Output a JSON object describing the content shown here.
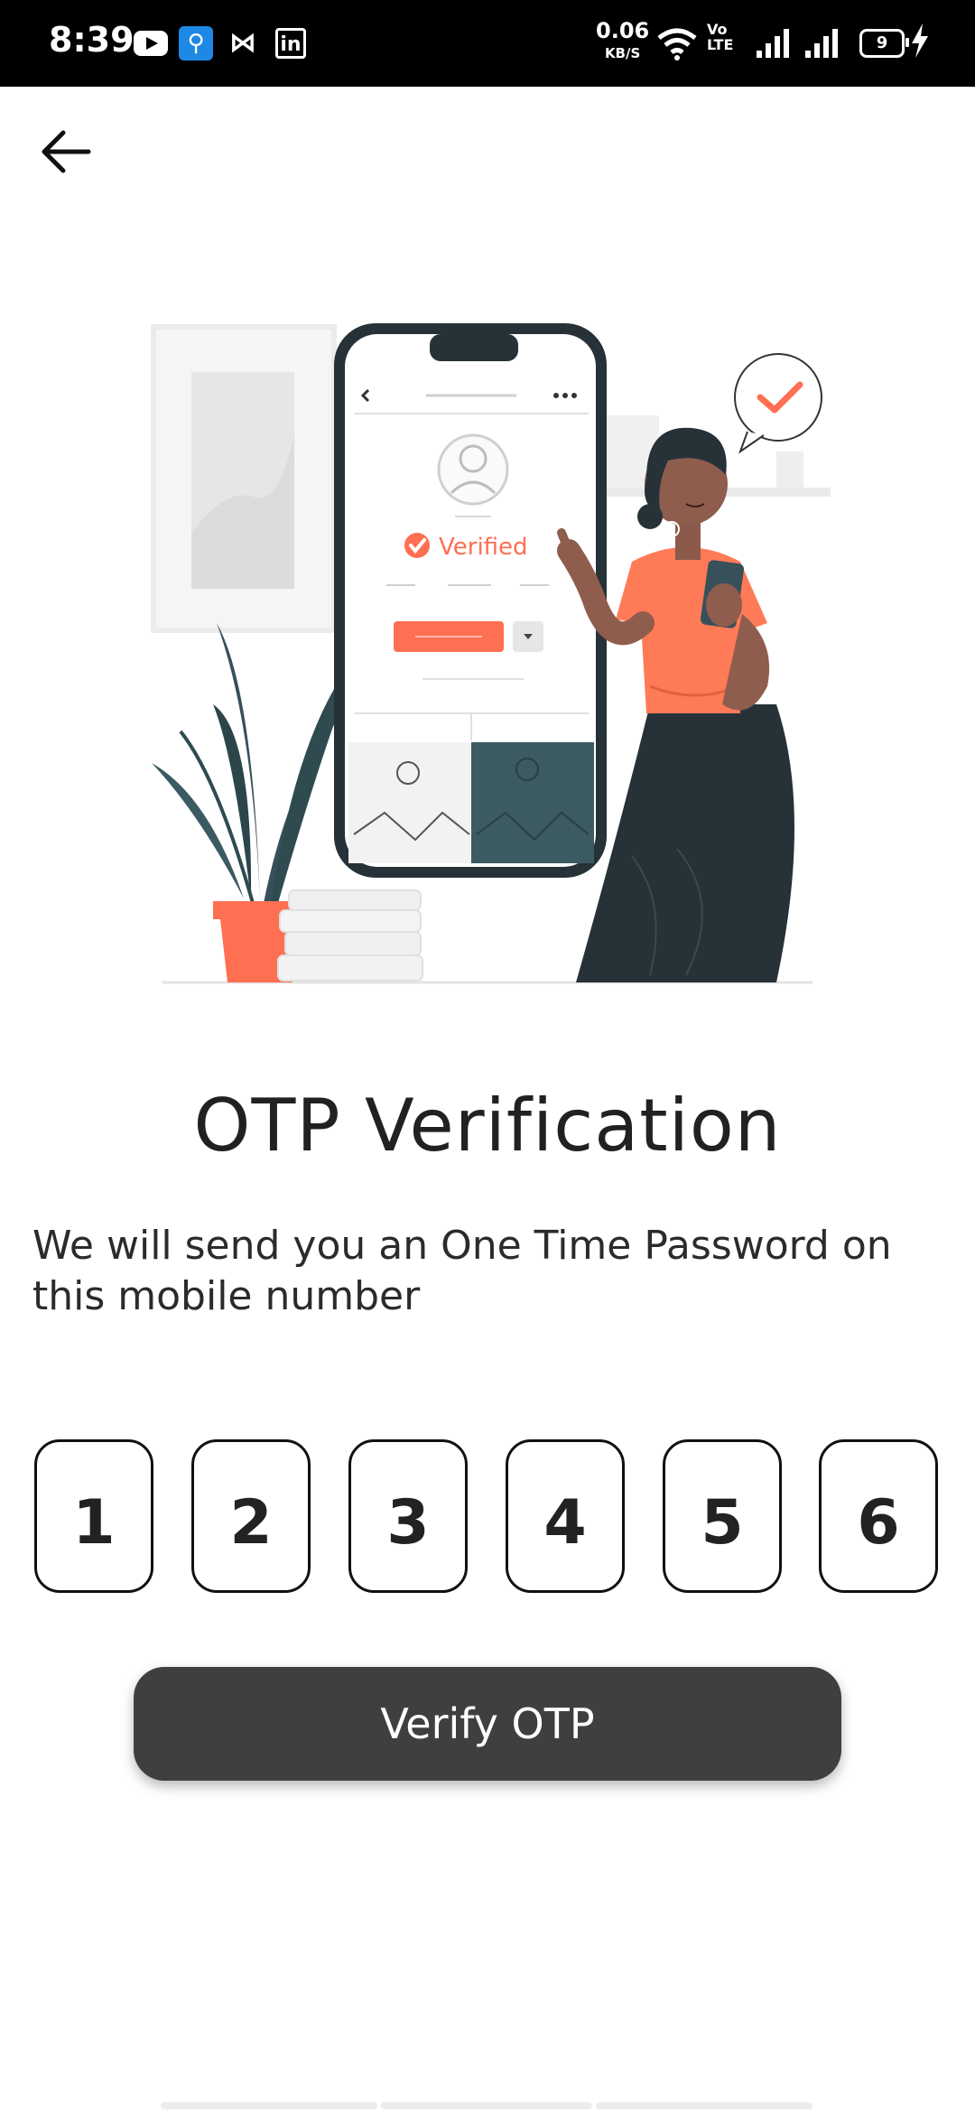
{
  "status_bar": {
    "time": "8:39",
    "net_speed_value": "0.06",
    "net_speed_unit": "KB/S",
    "volte_top": "Vo",
    "volte_bottom": "LTE",
    "battery": "9",
    "icons": [
      "youtube-icon",
      "usb-icon",
      "mx-icon",
      "linkedin-icon",
      "wifi-icon",
      "signal-icon",
      "signal-icon",
      "battery-icon",
      "charging-icon"
    ]
  },
  "header": {
    "back_icon": "arrow-left-icon"
  },
  "illustration": {
    "phone_badge": "Verified"
  },
  "main": {
    "title": "OTP Verification",
    "description": "We will send you an One Time Password on this mobile number",
    "otp_digits": [
      "1",
      "2",
      "3",
      "4",
      "5",
      "6"
    ],
    "verify_label": "Verify OTP"
  },
  "colors": {
    "accent": "#FF6F52",
    "dark_teal": "#263238",
    "button": "#3F3F3F"
  }
}
